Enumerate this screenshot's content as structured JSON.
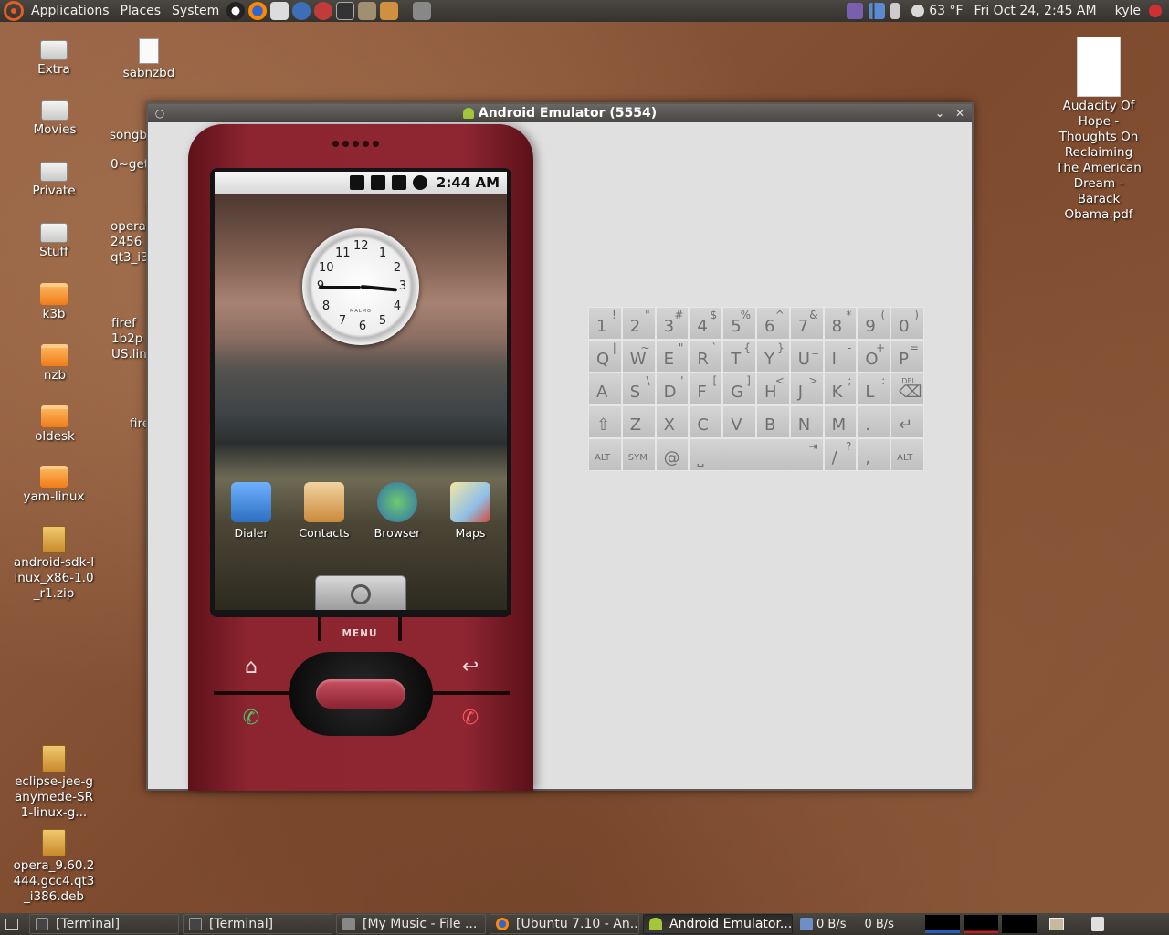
{
  "top_panel": {
    "menus": [
      "Applications",
      "Places",
      "System"
    ],
    "weather": "63 °F",
    "datetime": "Fri Oct 24,  2:45 AM",
    "user": "kyle"
  },
  "desktop": {
    "left_icons": [
      {
        "label": "Extra",
        "kind": "drive"
      },
      {
        "label": "Movies",
        "kind": "drive"
      },
      {
        "label": "Private",
        "kind": "drive"
      },
      {
        "label": "Stuff",
        "kind": "drive"
      },
      {
        "label": "k3b",
        "kind": "folder"
      },
      {
        "label": "nzb",
        "kind": "folder"
      },
      {
        "label": "oldesk",
        "kind": "folder"
      },
      {
        "label": "yam-linux",
        "kind": "folder"
      },
      {
        "label": "android-sdk-linux_x86-1.0_r1.zip",
        "kind": "package"
      },
      {
        "label": "eclipse-jee-ganymede-SR1-linux-g...",
        "kind": "package"
      },
      {
        "label": "opera_9.60.2444.gcc4.qt3_i386.deb",
        "kind": "package"
      }
    ],
    "second_column": [
      {
        "label": "sabnzbd",
        "kind": "document"
      },
      {
        "label": "songb",
        "kind": "folder"
      },
      {
        "label": "0~get",
        "kind": "text"
      },
      {
        "label": "opera 2456 qt3_i3",
        "kind": "package"
      },
      {
        "label": "firef 1b2p US.lin",
        "kind": "package"
      },
      {
        "label": "fire",
        "kind": "folder"
      }
    ],
    "right_icon": {
      "label": "Audacity Of Hope - Thoughts On Reclaiming The American Dream - Barack Obama.pdf"
    }
  },
  "emulator": {
    "title": "Android Emulator (5554)",
    "status_time": "2:44 AM",
    "clock_brand": "MALMO",
    "clock_numbers": [
      "12",
      "1",
      "2",
      "3",
      "4",
      "5",
      "6",
      "7",
      "8",
      "9",
      "10",
      "11"
    ],
    "home_apps": [
      {
        "label": "Dialer",
        "color": "#3a7fd0"
      },
      {
        "label": "Contacts",
        "color": "#c98a3a"
      },
      {
        "label": "Browser",
        "color": "#3f9b4a"
      },
      {
        "label": "Maps",
        "color": "#d24a3a"
      }
    ],
    "menu_label": "MENU",
    "phone_color": "#8e2632"
  },
  "keyboard": {
    "rows": [
      [
        [
          "1",
          "!"
        ],
        [
          "2",
          "\""
        ],
        [
          "3",
          "#"
        ],
        [
          "4",
          "$"
        ],
        [
          "5",
          "%"
        ],
        [
          "6",
          "^"
        ],
        [
          "7",
          "&"
        ],
        [
          "8",
          "*"
        ],
        [
          "9",
          "("
        ],
        [
          "0",
          ")"
        ]
      ],
      [
        [
          "Q",
          "|"
        ],
        [
          "W",
          "~"
        ],
        [
          "E",
          "\""
        ],
        [
          "R",
          "`"
        ],
        [
          "T",
          "{"
        ],
        [
          "Y",
          "}"
        ],
        [
          "U",
          "_"
        ],
        [
          "I",
          "-"
        ],
        [
          "O",
          "+"
        ],
        [
          "P",
          "="
        ]
      ],
      [
        [
          "A",
          ""
        ],
        [
          "S",
          "\\"
        ],
        [
          "D",
          "'"
        ],
        [
          "F",
          "["
        ],
        [
          "G",
          "]"
        ],
        [
          "H",
          "<"
        ],
        [
          "J",
          ">"
        ],
        [
          "K",
          ";"
        ],
        [
          "L",
          ":"
        ],
        [
          "⌫",
          "DEL"
        ]
      ],
      [
        [
          "⇧",
          ""
        ],
        [
          "Z",
          ""
        ],
        [
          "X",
          ""
        ],
        [
          "C",
          ""
        ],
        [
          "V",
          ""
        ],
        [
          "B",
          ""
        ],
        [
          "N",
          ""
        ],
        [
          "M",
          ""
        ],
        [
          ".",
          ""
        ],
        [
          "↵",
          ""
        ]
      ]
    ],
    "bottom_row": [
      "ALT",
      "SYM",
      "@",
      "⎵",
      "/",
      ",",
      "ALT"
    ],
    "bottom_row_alts": [
      "",
      "",
      "",
      "⇥",
      "?",
      "",
      ""
    ]
  },
  "bottom_panel": {
    "tasks": [
      {
        "label": "[Terminal]",
        "active": false
      },
      {
        "label": "[Terminal]",
        "active": false
      },
      {
        "label": "[My Music - File ...",
        "active": false
      },
      {
        "label": "[Ubuntu 7.10 - An...",
        "active": false
      },
      {
        "label": "Android Emulator...",
        "active": true
      }
    ],
    "net_down": "0 B/s",
    "net_up": "0 B/s"
  }
}
